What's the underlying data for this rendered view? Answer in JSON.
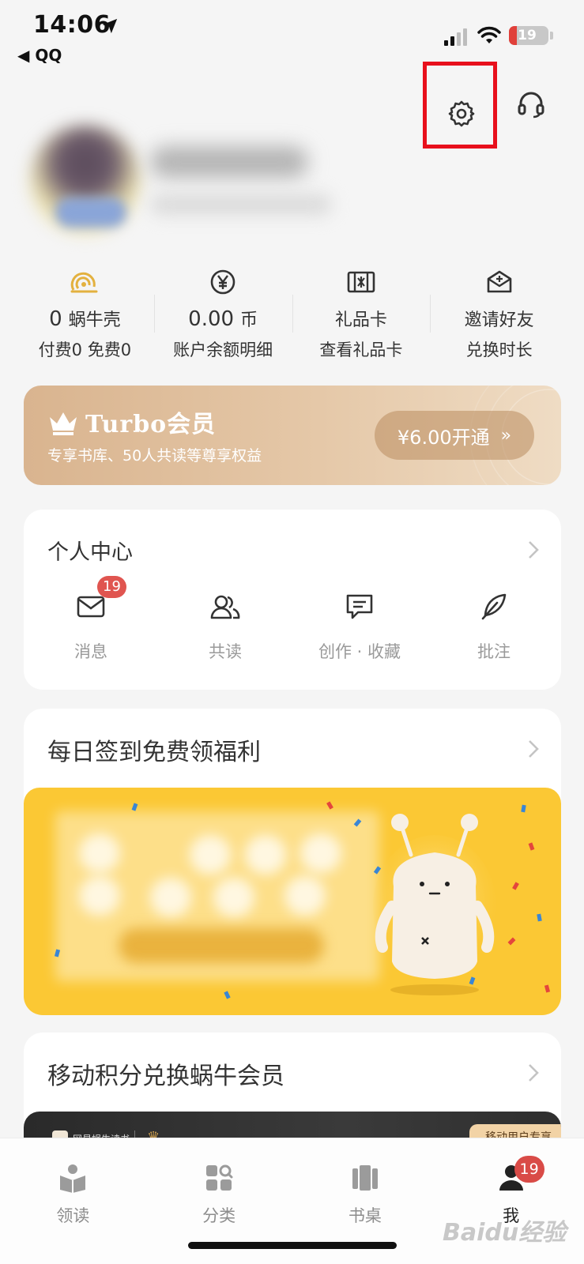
{
  "status_bar": {
    "time": "14:06",
    "back_app": "◀ QQ",
    "battery": "19",
    "battery_level_percent": 19
  },
  "top_actions": {
    "settings_icon": "gear-icon",
    "service_icon": "headset-icon",
    "highlight_color": "#e8101c"
  },
  "stats": [
    {
      "icon": "snail-shell-icon",
      "value": "0",
      "unit": "蜗牛壳",
      "sub": "付费0 免费0"
    },
    {
      "icon": "yen-coin-icon",
      "value": "0.00",
      "unit": "币",
      "sub": "账户余额明细"
    },
    {
      "icon": "gift-card-icon",
      "value": "",
      "unit": "礼品卡",
      "sub": "查看礼品卡"
    },
    {
      "icon": "invite-envelope-icon",
      "value": "",
      "unit": "邀请好友",
      "sub": "兑换时长"
    }
  ],
  "turbo": {
    "title": "Turbo会员",
    "subtitle": "专享书库、50人共读等尊享权益",
    "button": "¥6.00开通",
    "button_chevron": "»"
  },
  "personal_center": {
    "title": "个人中心",
    "items": [
      {
        "icon": "mail-icon",
        "label": "消息",
        "badge": "19"
      },
      {
        "icon": "people-icon",
        "label": "共读"
      },
      {
        "icon": "comment-icon",
        "label": "创作 · 收藏"
      },
      {
        "icon": "feather-icon",
        "label": "批注"
      }
    ]
  },
  "daily_signin": {
    "title": "每日签到免费领福利",
    "banner_color": "#fbc834"
  },
  "mobile_points": {
    "title": "移动积分兑换蜗牛会员",
    "banner_logo": "网易蜗牛读书",
    "banner_tag": "移动用户专享"
  },
  "tab_bar": {
    "tabs": [
      {
        "icon": "book-icon",
        "label": "领读"
      },
      {
        "icon": "category-icon",
        "label": "分类"
      },
      {
        "icon": "bookshelf-icon",
        "label": "书桌"
      },
      {
        "icon": "user-icon",
        "label": "我",
        "badge": "19",
        "active": true
      }
    ]
  },
  "watermark": "Baidu经验"
}
